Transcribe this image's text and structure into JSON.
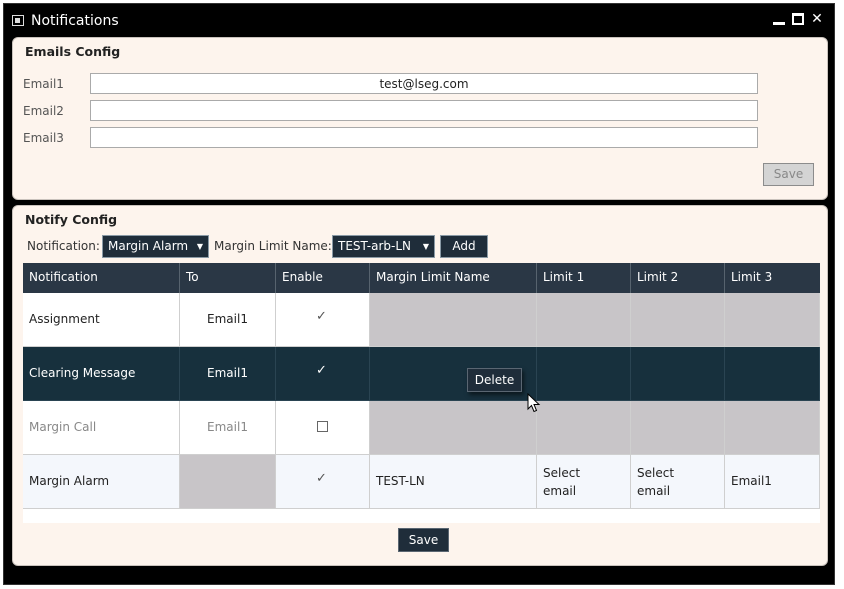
{
  "window": {
    "title": "Notifications"
  },
  "emails_config": {
    "title": "Emails Config",
    "fields": [
      {
        "label": "Email1",
        "value": "test@lseg.com"
      },
      {
        "label": "Email2",
        "value": ""
      },
      {
        "label": "Email3",
        "value": ""
      }
    ],
    "save_label": "Save"
  },
  "notify_config": {
    "title": "Notify Config",
    "notification_label": "Notification:",
    "notification_value": "Margin Alarm",
    "margin_limit_name_label": "Margin Limit Name:",
    "margin_limit_name_value": "TEST-arb-LN",
    "add_label": "Add",
    "columns": [
      "Notification",
      "To",
      "Enable",
      "Margin Limit Name",
      "Limit 1",
      "Limit 2",
      "Limit 3"
    ],
    "rows": [
      {
        "notification": "Assignment",
        "to": "Email1",
        "enabled": true,
        "margin_limit_name": "",
        "limit1": "",
        "limit2": "",
        "limit3": ""
      },
      {
        "notification": "Clearing Message",
        "to": "Email1",
        "enabled": true,
        "margin_limit_name": "",
        "limit1": "",
        "limit2": "",
        "limit3": ""
      },
      {
        "notification": "Margin Call",
        "to": "Email1",
        "enabled": false,
        "margin_limit_name": "",
        "limit1": "",
        "limit2": "",
        "limit3": ""
      },
      {
        "notification": "Margin Alarm",
        "to": "",
        "enabled": true,
        "margin_limit_name": "TEST-LN",
        "limit1": "Select email",
        "limit2": "Select email",
        "limit3": "Email1"
      }
    ],
    "context_menu_label": "Delete",
    "save_label": "Save"
  },
  "colors": {
    "panel_bg": "#fdf4ed",
    "header_bg": "#2a3745",
    "selected_row_bg": "#17303d",
    "disabled_cell_bg": "#c8c5c8"
  }
}
